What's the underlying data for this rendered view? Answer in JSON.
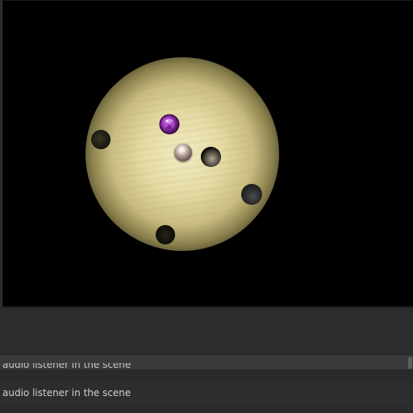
{
  "console": {
    "entries": [
      {
        "message": "audio listener in the scene"
      },
      {
        "message": "audio listener in the scene"
      }
    ]
  },
  "colors": {
    "viewport_background": "#000000",
    "panel_background": "#2b2b2b",
    "light_core": "#f3efc6",
    "gem": "#a23cc0",
    "log_text": "#d2d2d2"
  },
  "scene": {
    "objects": [
      {
        "kind": "light-spot",
        "name": "light-spot-icon"
      },
      {
        "kind": "hole",
        "name": "hole-icon"
      },
      {
        "kind": "hole",
        "name": "hole-icon"
      },
      {
        "kind": "hole",
        "name": "hole-icon"
      },
      {
        "kind": "hole",
        "name": "hole-icon"
      },
      {
        "kind": "ball",
        "name": "player-ball-icon"
      },
      {
        "kind": "gem",
        "name": "gem-icon"
      }
    ]
  }
}
